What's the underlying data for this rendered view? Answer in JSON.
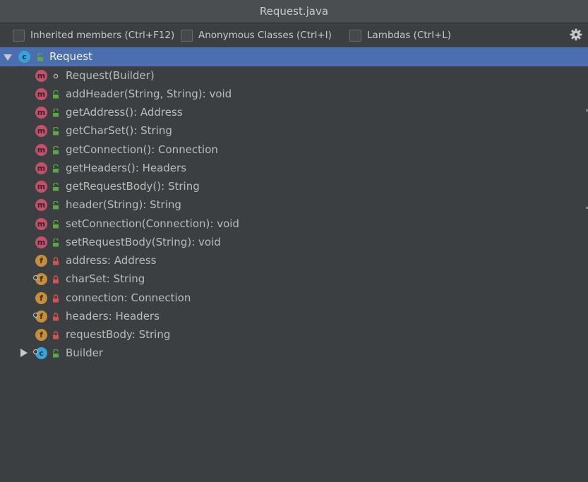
{
  "window": {
    "title": "Request.java"
  },
  "toolbar": {
    "options": [
      {
        "label": "Inherited members (Ctrl+F12)",
        "checked": false
      },
      {
        "label": "Anonymous Classes (Ctrl+I)",
        "checked": false
      },
      {
        "label": "Lambdas (Ctrl+L)",
        "checked": false
      }
    ],
    "settings_icon": "gear-icon"
  },
  "tree": {
    "root": {
      "label": "Request",
      "kind": "class",
      "expanded": true,
      "selected": true
    },
    "members": [
      {
        "label": "Request(Builder)",
        "kind": "method",
        "visibility": "package"
      },
      {
        "label": "addHeader(String, String): void",
        "kind": "method",
        "visibility": "public"
      },
      {
        "label": "getAddress(): Address",
        "kind": "method",
        "visibility": "public"
      },
      {
        "label": "getCharSet(): String",
        "kind": "method",
        "visibility": "public"
      },
      {
        "label": "getConnection(): Connection",
        "kind": "method",
        "visibility": "public"
      },
      {
        "label": "getHeaders(): Headers",
        "kind": "method",
        "visibility": "public"
      },
      {
        "label": "getRequestBody(): String",
        "kind": "method",
        "visibility": "public"
      },
      {
        "label": "header(String): String",
        "kind": "method",
        "visibility": "public"
      },
      {
        "label": "setConnection(Connection): void",
        "kind": "method",
        "visibility": "public"
      },
      {
        "label": "setRequestBody(String): void",
        "kind": "method",
        "visibility": "public"
      },
      {
        "label": "address: Address",
        "kind": "field",
        "visibility": "private",
        "final": false
      },
      {
        "label": "charSet: String",
        "kind": "field",
        "visibility": "private",
        "final": true
      },
      {
        "label": "connection: Connection",
        "kind": "field",
        "visibility": "private",
        "final": false
      },
      {
        "label": "headers: Headers",
        "kind": "field",
        "visibility": "private",
        "final": true
      },
      {
        "label": "requestBody: String",
        "kind": "field",
        "visibility": "private",
        "final": false
      }
    ],
    "nested": {
      "label": "Builder",
      "kind": "class",
      "expanded": false,
      "static": true
    }
  },
  "badge_letters": {
    "method": "m",
    "field": "f",
    "class": "c"
  },
  "colors": {
    "method": "#c2526b",
    "field": "#c58e3a",
    "class": "#3aa2d8",
    "public": "#5ea843",
    "private": "#d4534f",
    "selection": "#4b6eaf"
  }
}
